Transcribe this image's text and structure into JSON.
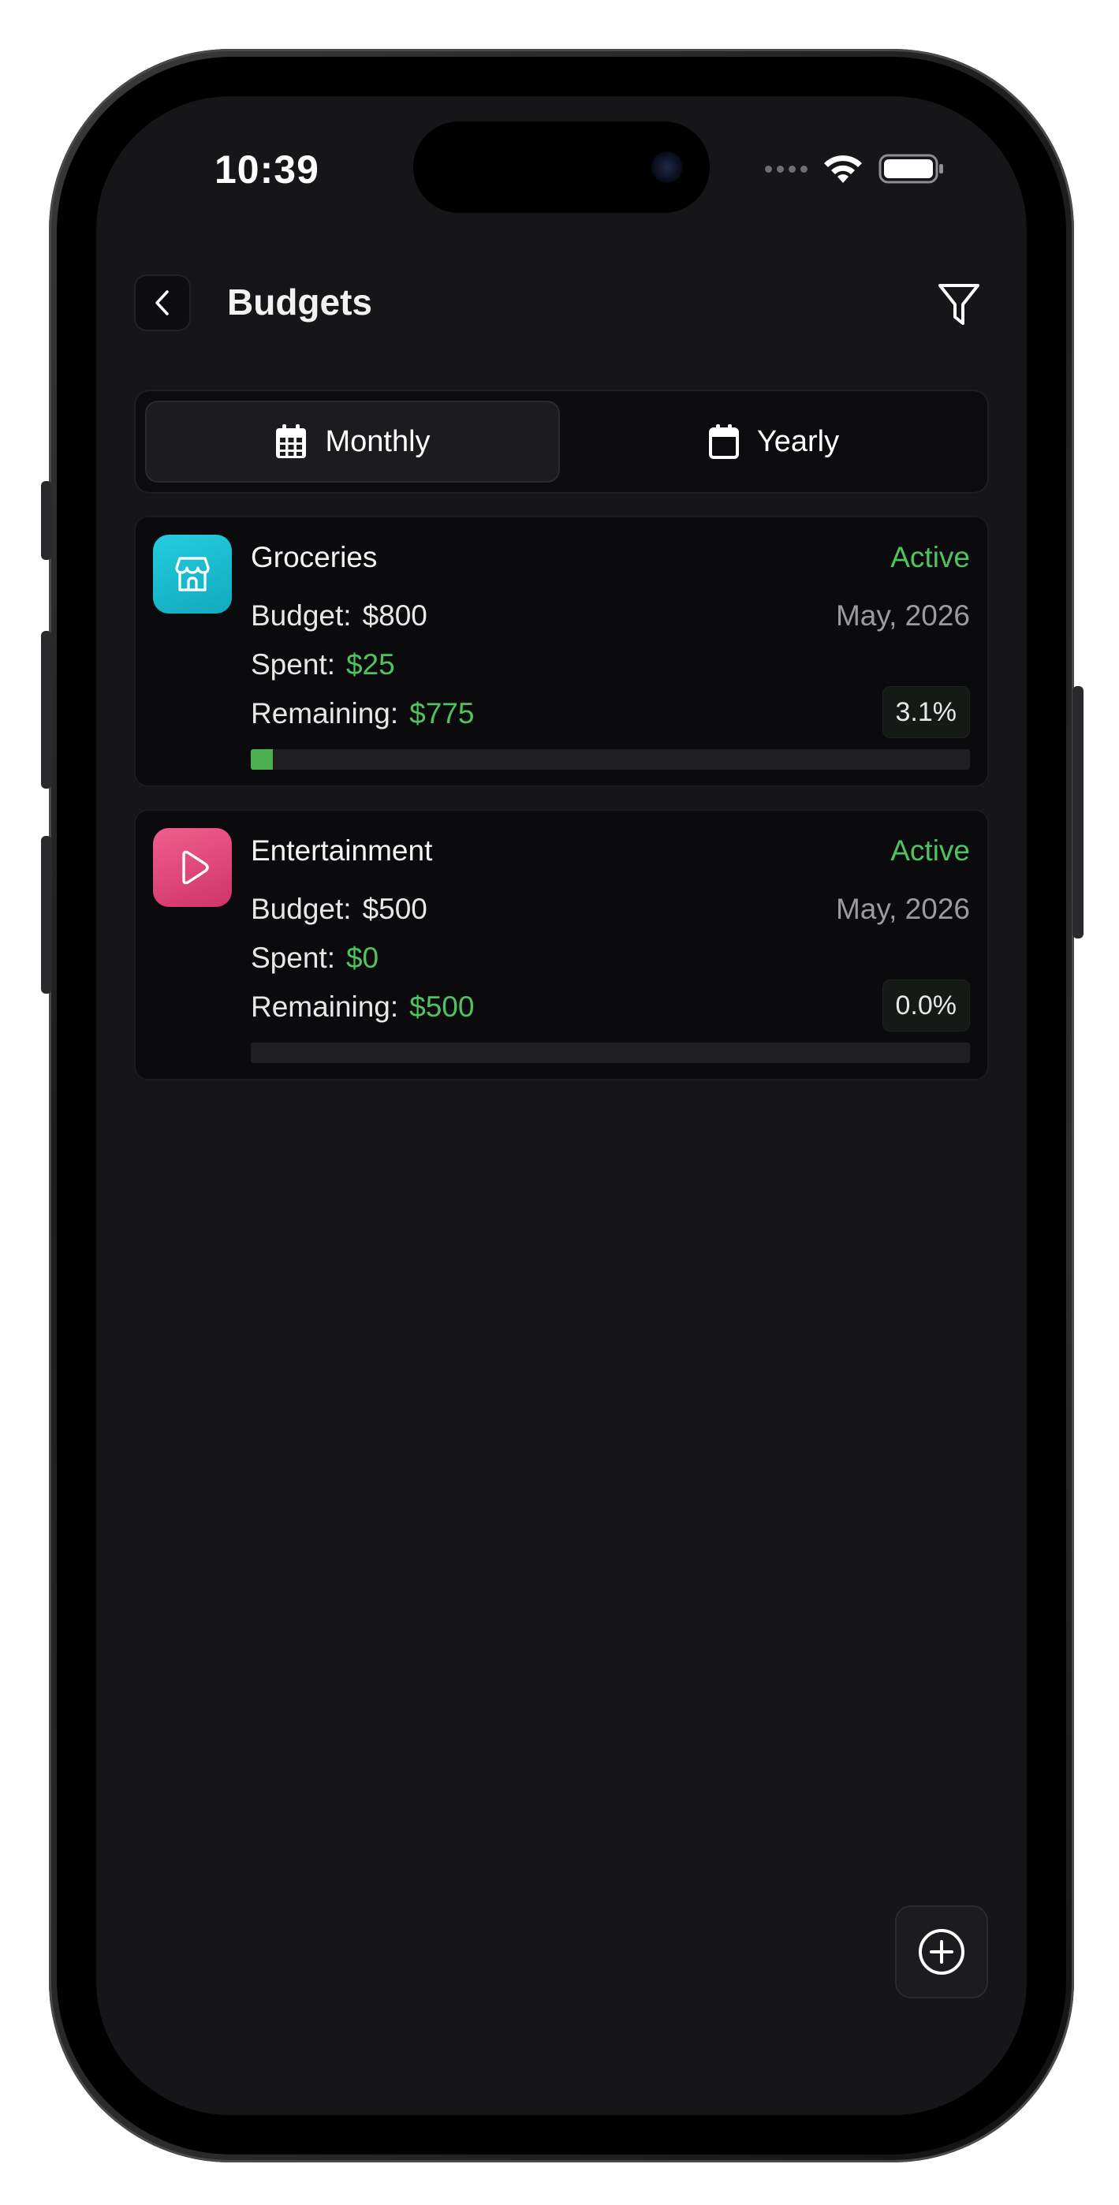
{
  "status_bar": {
    "time": "10:39",
    "icons": [
      "cellular-icon",
      "wifi-icon",
      "battery-icon"
    ]
  },
  "header": {
    "title": "Budgets",
    "back_icon": "chevron-left-icon",
    "filter_icon": "filter-icon"
  },
  "tabs": [
    {
      "label": "Monthly",
      "icon": "calendar-grid-icon",
      "active": true
    },
    {
      "label": "Yearly",
      "icon": "calendar-icon",
      "active": false
    }
  ],
  "budgets": [
    {
      "name": "Groceries",
      "icon": "storefront-icon",
      "icon_color": "#19bfd1",
      "status": "Active",
      "period": "May, 2026",
      "budget_label": "Budget:",
      "budget_value": "$800",
      "spent_label": "Spent:",
      "spent_value": "$25",
      "remaining_label": "Remaining:",
      "remaining_value": "$775",
      "percent": "3.1%",
      "progress_fraction": 0.031
    },
    {
      "name": "Entertainment",
      "icon": "play-icon",
      "icon_color": "#e0487a",
      "status": "Active",
      "period": "May, 2026",
      "budget_label": "Budget:",
      "budget_value": "$500",
      "spent_label": "Spent:",
      "spent_value": "$0",
      "remaining_label": "Remaining:",
      "remaining_value": "$500",
      "percent": "0.0%",
      "progress_fraction": 0.0
    }
  ],
  "fab": {
    "icon": "plus-circle-icon"
  },
  "colors": {
    "accent_green": "#4fc35f",
    "background": "#161618",
    "card": "#0b0b0d"
  }
}
